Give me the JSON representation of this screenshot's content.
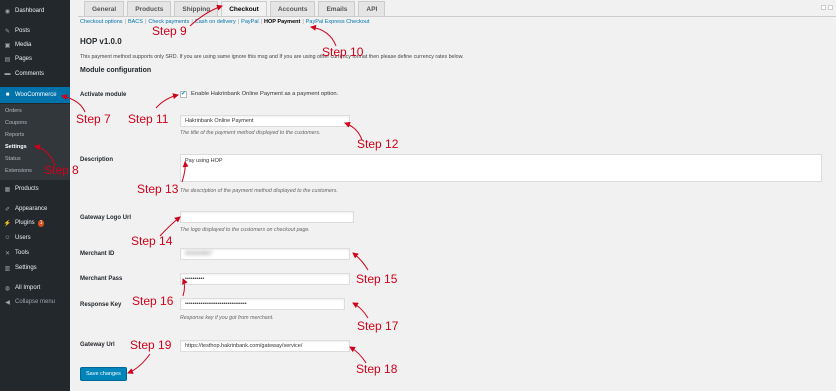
{
  "sidebar": {
    "items": [
      {
        "label": "Dashboard",
        "icon": "dashboard-icon"
      },
      {
        "label": "Posts",
        "icon": "pin-icon"
      },
      {
        "label": "Media",
        "icon": "media-icon"
      },
      {
        "label": "Pages",
        "icon": "pages-icon"
      },
      {
        "label": "Comments",
        "icon": "comment-icon"
      },
      {
        "label": "WooCommerce",
        "icon": "woocommerce-icon"
      }
    ],
    "woo_sub": [
      "Orders",
      "Coupons",
      "Reports",
      "Settings",
      "Status",
      "Extensions"
    ],
    "lower": [
      {
        "label": "Products",
        "icon": "products-icon"
      },
      {
        "label": "Appearance",
        "icon": "brush-icon"
      },
      {
        "label": "Plugins",
        "icon": "plugin-icon",
        "badge": "1"
      },
      {
        "label": "Users",
        "icon": "users-icon"
      },
      {
        "label": "Tools",
        "icon": "wrench-icon"
      },
      {
        "label": "Settings",
        "icon": "settings-icon"
      },
      {
        "label": "All Import",
        "icon": "import-icon"
      },
      {
        "label": "Collapse menu",
        "icon": "collapse-icon"
      }
    ]
  },
  "tabs": [
    "General",
    "Products",
    "Shipping",
    "Checkout",
    "Accounts",
    "Emails",
    "API"
  ],
  "subsub": {
    "items": [
      "Checkout options",
      "BACS",
      "Check payments",
      "Cash on delivery",
      "PayPal",
      "HOP Payment",
      "PayPal Express Checkout"
    ]
  },
  "title": "HOP v1.0.0",
  "intro": "This payment method supports only SRD. If you are using same ignore this msg and If you are using other currency format then please define currency rates below.",
  "section": "Module configuration",
  "fields": {
    "activate": {
      "label": "Activate module",
      "checkbox_text": "Enable Hakrinbank Online Payment as a payment option."
    },
    "title": {
      "value": "Hakrinbank Online Payment",
      "desc": "The title of the payment method displayed to the customers."
    },
    "description": {
      "label": "Description",
      "value": "Pay using HOP",
      "desc": "The description of the payment method displayed to the customers."
    },
    "logo": {
      "label": "Gateway Logo Url",
      "value": "",
      "desc": "The logo displayed to the customers on checkout page."
    },
    "merchant_id": {
      "label": "Merchant ID",
      "value": "000000837"
    },
    "merchant_pass": {
      "label": "Merchant Pass",
      "value": "••••••••••"
    },
    "response_key": {
      "label": "Response Key",
      "value": "••••••••••••••••••••••••••••••••",
      "desc": "Response key if you got from merchant."
    },
    "gateway_url": {
      "label": "Gateway Url",
      "value": "https://testhop.hakrinbank.com/gateway/service/"
    }
  },
  "save_label": "Save changes",
  "steps": [
    "Step 7",
    "Step 8",
    "Step 9",
    "Step 10",
    "Step 11",
    "Step 12",
    "Step 13",
    "Step 14",
    "Step 15",
    "Step 16",
    "Step 17",
    "Step 18",
    "Step 19"
  ],
  "colors": {
    "annotation": "#d0021b",
    "accent": "#0073aa",
    "sidebar": "#23282d"
  }
}
